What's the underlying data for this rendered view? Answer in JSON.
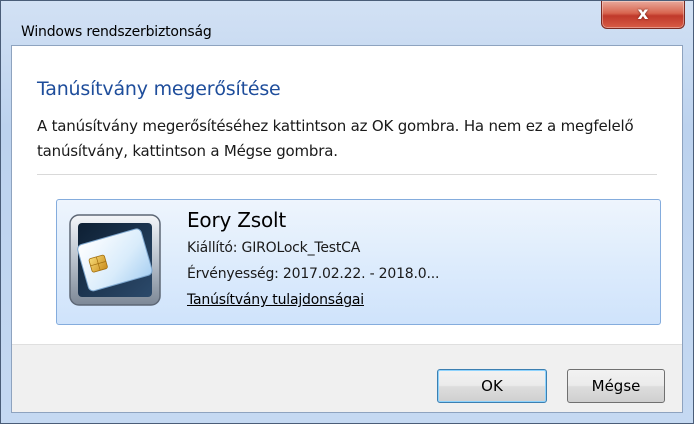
{
  "window": {
    "title": "Windows rendszerbiztonság",
    "close_glyph": "x"
  },
  "dialog": {
    "heading": "Tanúsítvány megerősítése",
    "description": "A tanúsítvány megerősítéséhez kattintson az OK gombra. Ha nem ez a megfelelő tanúsítvány, kattintson a Mégse gombra."
  },
  "certificate": {
    "icon": "smart-card-icon",
    "name": "Eory Zsolt",
    "issuer": "Kiállító: GIROLock_TestCA",
    "validity": "Érvényesség: 2017.02.22. - 2018.0...",
    "properties_link": "Tanúsítvány tulajdonságai"
  },
  "buttons": {
    "ok": "OK",
    "cancel": "Mégse"
  },
  "colors": {
    "heading": "#1e4d9b",
    "close_button": "#c0392b",
    "tile_border": "#84acdd",
    "tile_background": "#dcebfc"
  }
}
